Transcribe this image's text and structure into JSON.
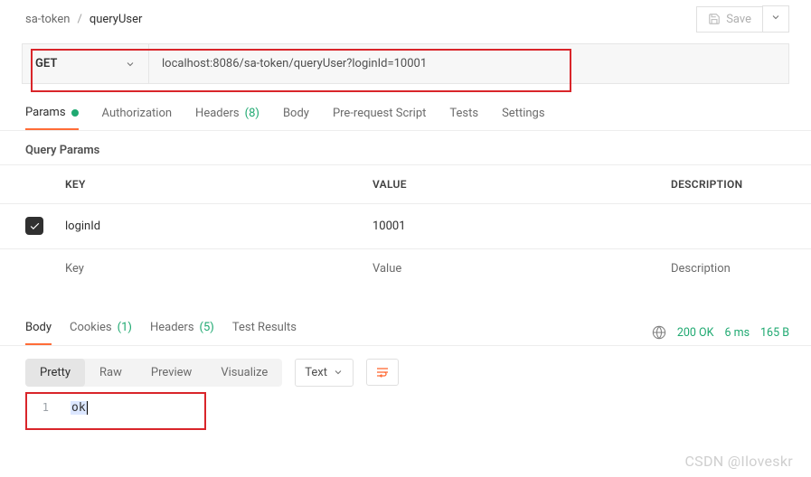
{
  "breadcrumb": {
    "parent": "sa-token",
    "current": "queryUser"
  },
  "save": {
    "label": "Save"
  },
  "request": {
    "method": "GET",
    "url": "localhost:8086/sa-token/queryUser?loginId=10001"
  },
  "tabs": {
    "params": "Params",
    "authorization": "Authorization",
    "headers": "Headers",
    "headers_count": "(8)",
    "body": "Body",
    "prerequest": "Pre-request Script",
    "tests": "Tests",
    "settings": "Settings"
  },
  "query_params": {
    "title": "Query Params",
    "header_key": "KEY",
    "header_value": "VALUE",
    "header_description": "DESCRIPTION",
    "rows": [
      {
        "checked": true,
        "key": "loginId",
        "value": "10001",
        "description": ""
      }
    ],
    "placeholder_key": "Key",
    "placeholder_value": "Value",
    "placeholder_description": "Description"
  },
  "response_tabs": {
    "body": "Body",
    "cookies": "Cookies",
    "cookies_count": "(1)",
    "headers": "Headers",
    "headers_count": "(5)",
    "test_results": "Test Results"
  },
  "response_status": {
    "code": "200 OK",
    "time": "6 ms",
    "size": "165 B"
  },
  "view_tabs": {
    "pretty": "Pretty",
    "raw": "Raw",
    "preview": "Preview",
    "visualize": "Visualize"
  },
  "format": {
    "label": "Text"
  },
  "response_body": {
    "lines": [
      {
        "n": "1",
        "text": "ok"
      }
    ]
  },
  "watermark": "CSDN @Iloveskr"
}
